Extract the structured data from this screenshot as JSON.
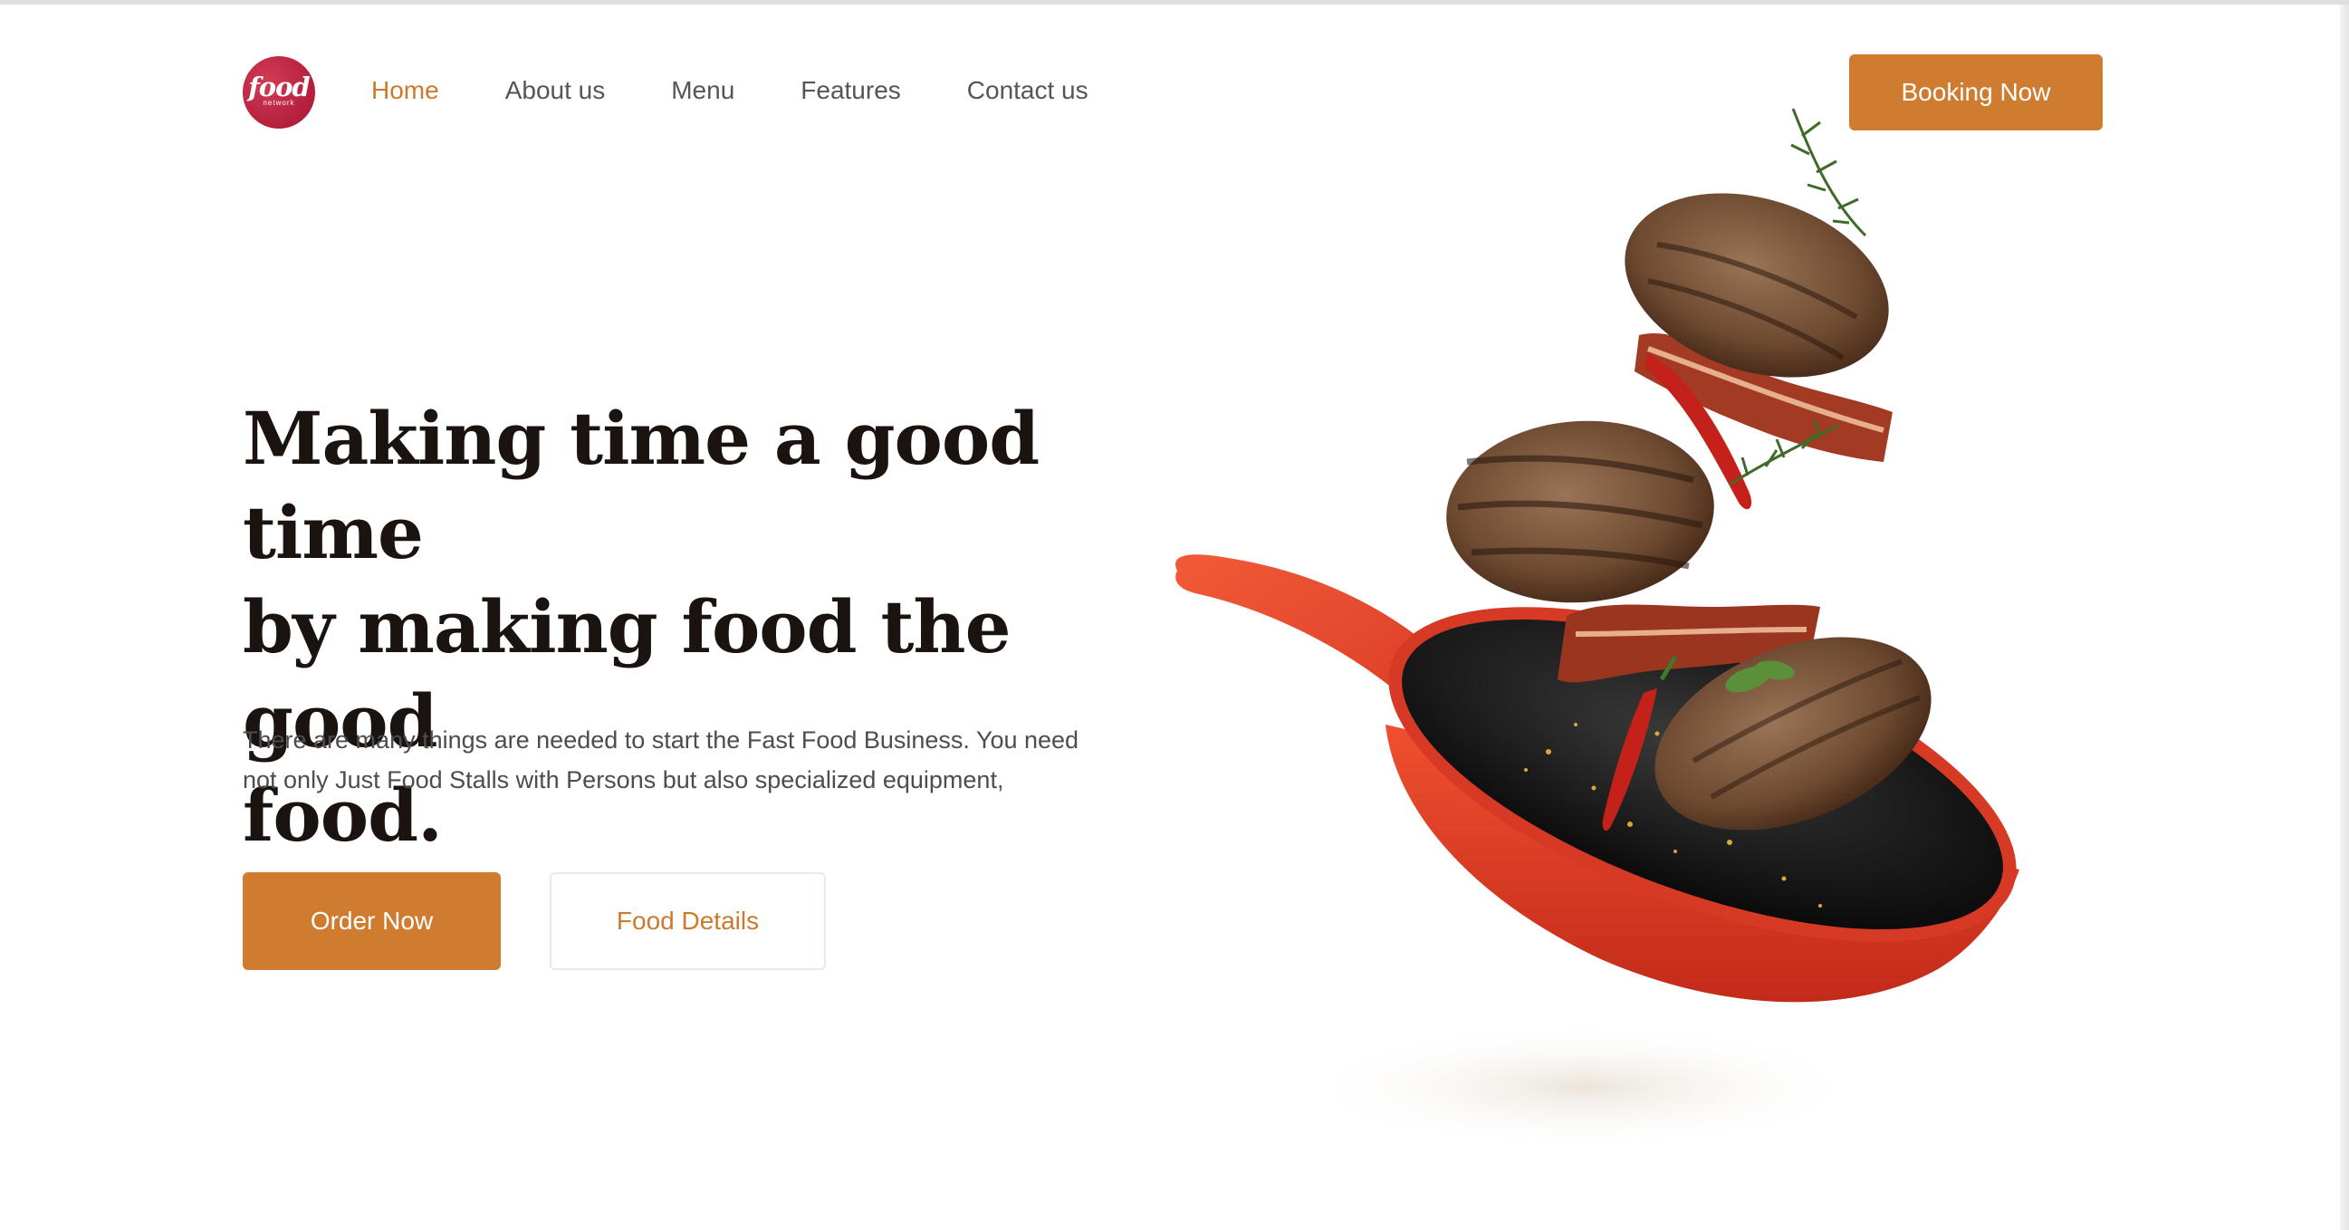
{
  "brand": {
    "logo_text": "food",
    "logo_subtext": "network"
  },
  "nav": {
    "items": [
      {
        "label": "Home",
        "active": true
      },
      {
        "label": "About us",
        "active": false
      },
      {
        "label": "Menu",
        "active": false
      },
      {
        "label": "Features",
        "active": false
      },
      {
        "label": "Contact us",
        "active": false
      }
    ],
    "cta_label": "Booking Now"
  },
  "hero": {
    "title_lines": [
      "Making time a good time",
      "by making food the good",
      "food."
    ],
    "description_lines": [
      "There are many things are needed to start the Fast Food Business. You need",
      "not only Just Food Stalls with Persons but also specialized equipment,"
    ],
    "primary_button": "Order Now",
    "secondary_button": "Food Details"
  },
  "colors": {
    "accent": "#cf7c30",
    "heading": "#1b1310",
    "body_text": "#4d4d4d",
    "nav_text": "#555555",
    "logo_red": "#b31f3c",
    "pan_red": "#e8432e"
  },
  "illustration": {
    "subject": "red frying pan with flying grilled burger patties, bacon, chili and rosemary"
  }
}
